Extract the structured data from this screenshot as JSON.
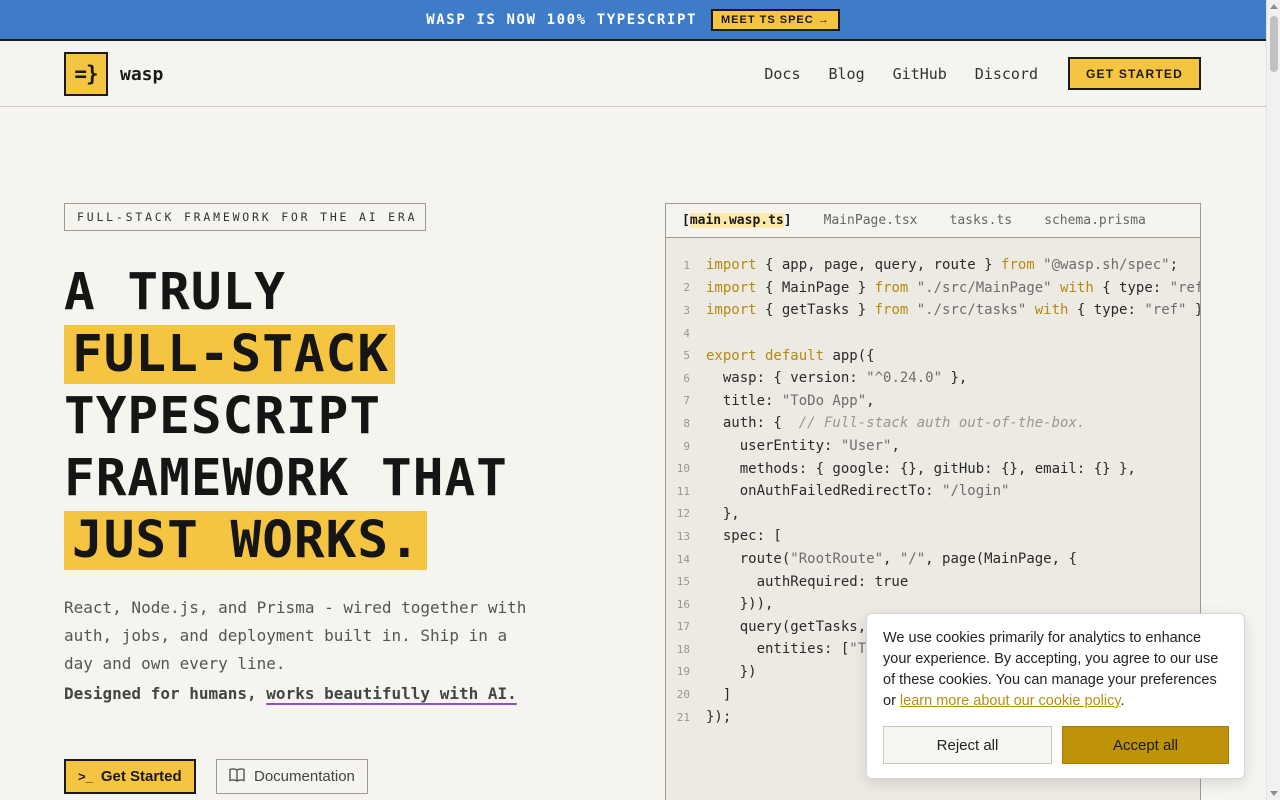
{
  "announcement": {
    "text": "WASP IS NOW 100% TYPESCRIPT",
    "button_label": "MEET TS SPEC →"
  },
  "nav": {
    "logo_mark": "=}",
    "logo_text": "wasp",
    "links": [
      "Docs",
      "Blog",
      "GitHub",
      "Discord"
    ],
    "cta_label": "GET STARTED"
  },
  "hero": {
    "tagline": "FULL-STACK FRAMEWORK FOR THE AI ERA",
    "headline": {
      "line1": "A TRULY",
      "line2": "FULL-STACK",
      "line3": "TYPESCRIPT",
      "line4": "FRAMEWORK THAT",
      "line5": "JUST WORKS."
    },
    "description": "React, Node.js, and Prisma - wired together with auth, jobs, and deployment built in. Ship in a day and own every line.",
    "designed_prefix": "Designed for humans, ",
    "designed_link": "works beautifully with AI.",
    "primary_button": {
      "icon": ">_",
      "label": "Get Started"
    },
    "secondary_button": {
      "icon": "book-icon",
      "label": "Documentation"
    }
  },
  "code_panel": {
    "tabs": [
      {
        "label": "main.wasp.ts",
        "active": true
      },
      {
        "label": "MainPage.tsx",
        "active": false
      },
      {
        "label": "tasks.ts",
        "active": false
      },
      {
        "label": "schema.prisma",
        "active": false
      }
    ],
    "lines": [
      [
        [
          "kw",
          "import"
        ],
        [
          "plain",
          " { app, page, query, route } "
        ],
        [
          "kw",
          "from"
        ],
        [
          "str",
          " \"@wasp.sh/spec\""
        ],
        [
          "plain",
          ";"
        ]
      ],
      [
        [
          "kw",
          "import"
        ],
        [
          "plain",
          " { MainPage } "
        ],
        [
          "kw",
          "from"
        ],
        [
          "str",
          " \"./src/MainPage\""
        ],
        [
          "kw",
          " with"
        ],
        [
          "plain",
          " { type: "
        ],
        [
          "str",
          "\"ref\""
        ],
        [
          "plain",
          " }"
        ]
      ],
      [
        [
          "kw",
          "import"
        ],
        [
          "plain",
          " { getTasks } "
        ],
        [
          "kw",
          "from"
        ],
        [
          "str",
          " \"./src/tasks\""
        ],
        [
          "kw",
          " with"
        ],
        [
          "plain",
          " { type: "
        ],
        [
          "str",
          "\"ref\""
        ],
        [
          "plain",
          " };"
        ]
      ],
      [],
      [
        [
          "kw",
          "export default"
        ],
        [
          "plain",
          " app({"
        ]
      ],
      [
        [
          "plain",
          "  wasp: { version: "
        ],
        [
          "str",
          "\"^0.24.0\""
        ],
        [
          "plain",
          " },"
        ]
      ],
      [
        [
          "plain",
          "  title: "
        ],
        [
          "str",
          "\"ToDo App\""
        ],
        [
          "plain",
          ","
        ]
      ],
      [
        [
          "plain",
          "  auth: {  "
        ],
        [
          "cm",
          "// Full-stack auth out-of-the-box."
        ]
      ],
      [
        [
          "plain",
          "    userEntity: "
        ],
        [
          "str",
          "\"User\""
        ],
        [
          "plain",
          ","
        ]
      ],
      [
        [
          "plain",
          "    methods: { google: {}, gitHub: {}, email: {} },"
        ]
      ],
      [
        [
          "plain",
          "    onAuthFailedRedirectTo: "
        ],
        [
          "str",
          "\"/login\""
        ]
      ],
      [
        [
          "plain",
          "  },"
        ]
      ],
      [
        [
          "plain",
          "  spec: ["
        ]
      ],
      [
        [
          "plain",
          "    route("
        ],
        [
          "str",
          "\"RootRoute\""
        ],
        [
          "plain",
          ", "
        ],
        [
          "str",
          "\"/\""
        ],
        [
          "plain",
          ", page(MainPage, {"
        ]
      ],
      [
        [
          "plain",
          "      authRequired: true"
        ]
      ],
      [
        [
          "plain",
          "    })),"
        ]
      ],
      [
        [
          "plain",
          "    query(getTasks,"
        ]
      ],
      [
        [
          "plain",
          "      entities: ["
        ],
        [
          "str",
          "\"Ta"
        ]
      ],
      [
        [
          "plain",
          "    })"
        ]
      ],
      [
        [
          "plain",
          "  ]"
        ]
      ],
      [
        [
          "plain",
          "});"
        ]
      ]
    ]
  },
  "cookie_banner": {
    "text": "We use cookies primarily for analytics to enhance your experience. By accepting, you agree to our use of these cookies. You can manage your preferences or ",
    "link_text": "learn more about our cookie policy",
    "text_end": ".",
    "reject_label": "Reject all",
    "accept_label": "Accept all"
  },
  "colors": {
    "accent_yellow": "#f5c542",
    "announcement_blue": "#3e7cc8",
    "accept_gold": "#bf9308",
    "page_bg": "#f5f4ef"
  }
}
